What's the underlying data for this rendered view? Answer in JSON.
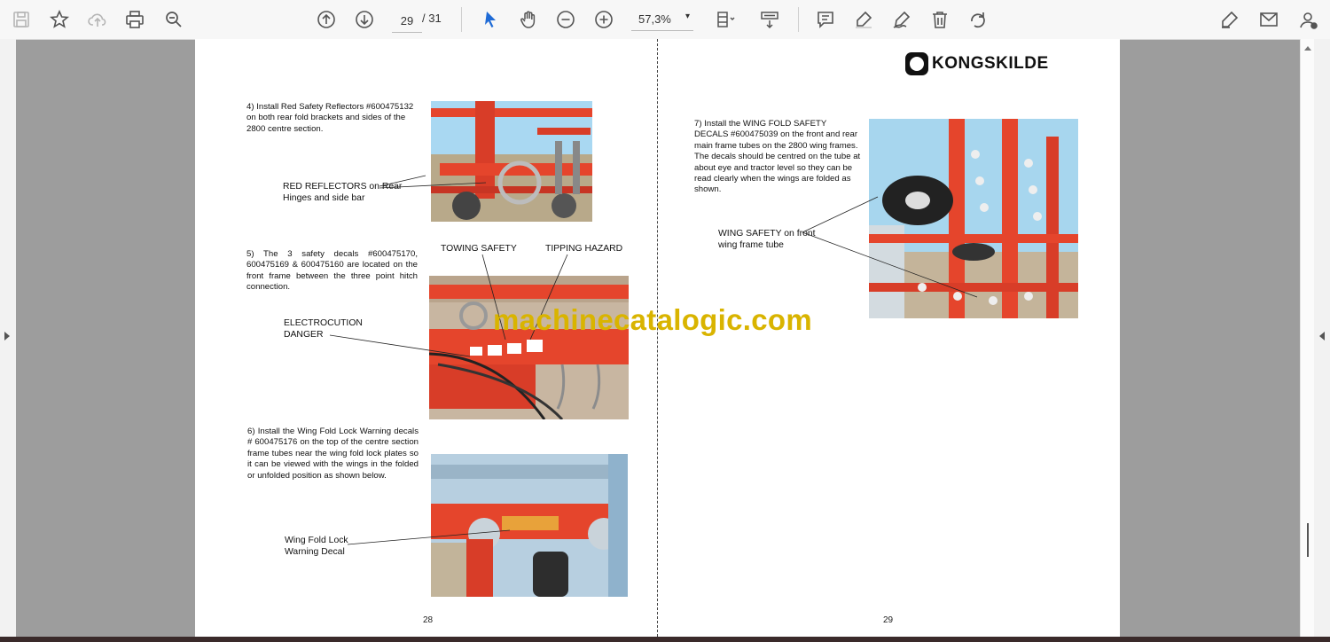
{
  "toolbar": {
    "current_page": "29",
    "total_pages": "/ 31",
    "zoom": "57,3%",
    "zoom_caret": "▾",
    "icons": [
      "save-icon",
      "bookmark-star-icon",
      "upload-cloud-icon",
      "print-icon",
      "zoom-search-icon",
      "page-up-icon",
      "page-down-icon",
      "select-cursor-icon",
      "hand-tool-icon",
      "zoom-out-icon",
      "zoom-in-icon",
      "page-fit-icon",
      "scroll-mode-icon",
      "comment-icon",
      "highlight-icon",
      "draw-icon",
      "delete-icon",
      "rotate-icon",
      "sign-icon",
      "mail-icon",
      "account-icon"
    ]
  },
  "left_page": {
    "step4": "4) Install Red Safety Reflectors #600475132 on both rear fold brackets and sides of the 2800 centre section.",
    "label_reflectors": "RED REFLECTORS on Rear Hinges and side bar",
    "step5": "5) The 3 safety decals #600475170, 600475169 & 600475160 are located on the front frame between the three point hitch connection.",
    "label_towing": "TOWING  SAFETY",
    "label_tipping": "TIPPING HAZARD",
    "label_electro": "ELECTROCUTION DANGER",
    "step6": "6) Install the Wing Fold Lock Warning decals # 600475176 on the top of the centre section frame tubes near the wing fold lock plates so it can be viewed with the wings in the folded or unfolded position as shown below.",
    "label_winglock": "Wing Fold Lock Warning Decal",
    "page_number": "28"
  },
  "right_page": {
    "logo": "KONGSKILDE",
    "step7": "7) Install the WING FOLD SAFETY DECALS #600475039 on the front and rear main frame tubes on the 2800 wing frames. The decals should be centred on the tube at about eye and tractor level so they can be read clearly when the wings are folded as shown.",
    "label_wingsafety": "WING SAFETY on front wing frame tube",
    "page_number": "29"
  },
  "watermark": "machinecatalogic.com",
  "colors": {
    "accent": "#1f6bd6",
    "machine_orange": "#e5452c",
    "watermark": "#d9b400"
  }
}
